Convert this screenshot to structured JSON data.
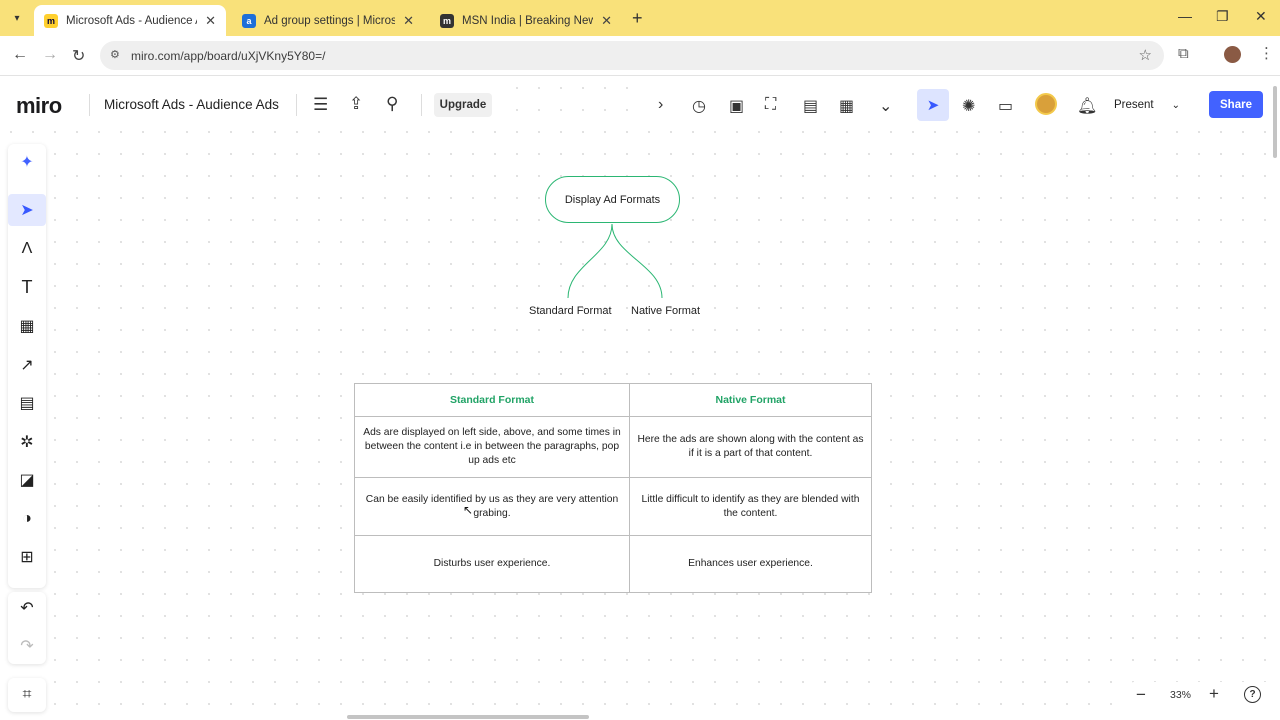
{
  "browser": {
    "tabs": [
      {
        "title": "Microsoft Ads - Audience Ads",
        "active": true
      },
      {
        "title": "Ad group settings | Microsoft A",
        "active": false
      },
      {
        "title": "MSN India | Breaking News, Ent",
        "active": false
      }
    ],
    "url": "miro.com/app/board/uXjVKny5Y80=/"
  },
  "miro": {
    "logo": "miro",
    "board_title": "Microsoft Ads - Audience Ads",
    "upgrade_label": "Upgrade",
    "present_label": "Present",
    "share_label": "Share",
    "zoom_level": "33%"
  },
  "mindmap": {
    "root": "Display Ad Formats",
    "children": [
      "Standard Format",
      "Native Format"
    ]
  },
  "table": {
    "headers": [
      "Standard Format",
      "Native Format"
    ],
    "rows": [
      [
        "Ads are displayed on left side, above, and some times in between the content i.e in between the paragraphs, pop up ads etc",
        "Here the ads are shown along with the content as if it is a part of that content."
      ],
      [
        "Can be easily identified by us as they are very attention grabing.",
        "Little difficult to identify as they are blended with the content."
      ],
      [
        "Disturbs user experience.",
        "Enhances user experience."
      ]
    ]
  },
  "colors": {
    "tab_strip": "#f9e17a",
    "accent_green": "#21a366",
    "share_blue": "#4262ff"
  }
}
